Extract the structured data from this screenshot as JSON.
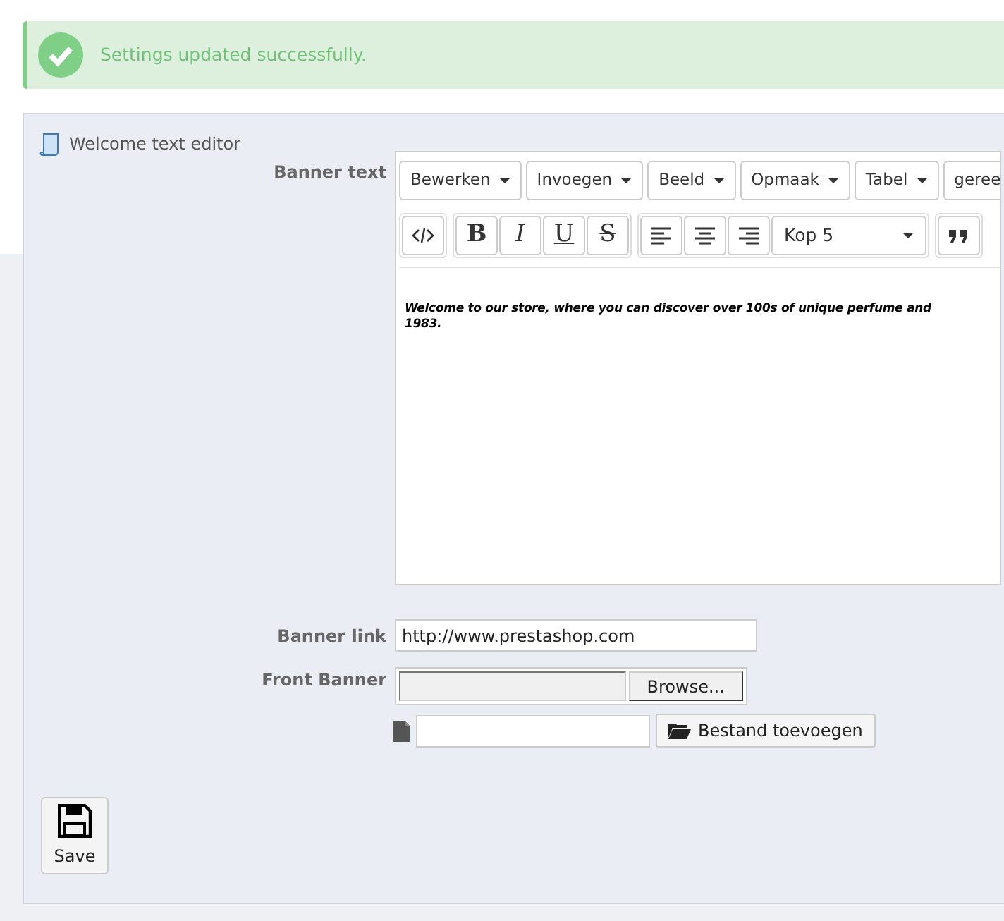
{
  "alert": {
    "kind": "success",
    "text": "Settings updated successfully."
  },
  "panel": {
    "title": "Welcome text editor"
  },
  "banner_text": {
    "label": "Banner text",
    "menubar": [
      {
        "label": "Bewerken",
        "caret": true
      },
      {
        "label": "Invoegen",
        "caret": true
      },
      {
        "label": "Beeld",
        "caret": true
      },
      {
        "label": "Opmaak",
        "caret": true
      },
      {
        "label": "Tabel",
        "caret": true
      },
      {
        "label": "geree",
        "caret": false
      }
    ],
    "toolbar": [
      [
        {
          "kind": "code"
        }
      ],
      [
        {
          "kind": "bold",
          "text": "B"
        },
        {
          "kind": "italic",
          "text": "I"
        },
        {
          "kind": "underline",
          "text": "U"
        },
        {
          "kind": "strike",
          "text": "S"
        }
      ],
      [
        {
          "kind": "align-left"
        },
        {
          "kind": "align-center"
        },
        {
          "kind": "align-right"
        },
        {
          "kind": "select",
          "value": "Kop 5"
        }
      ],
      [
        {
          "kind": "quote"
        }
      ]
    ],
    "content_lines": [
      "Welcome to our store, where you can discover over 100s of unique perfume and",
      "1983."
    ]
  },
  "banner_link": {
    "label": "Banner link",
    "value": "http://www.prestashop.com"
  },
  "front_banner": {
    "label": "Front Banner",
    "browse": "Browse...",
    "add_button": "Bestand toevoegen"
  },
  "save": {
    "label": "Save"
  }
}
